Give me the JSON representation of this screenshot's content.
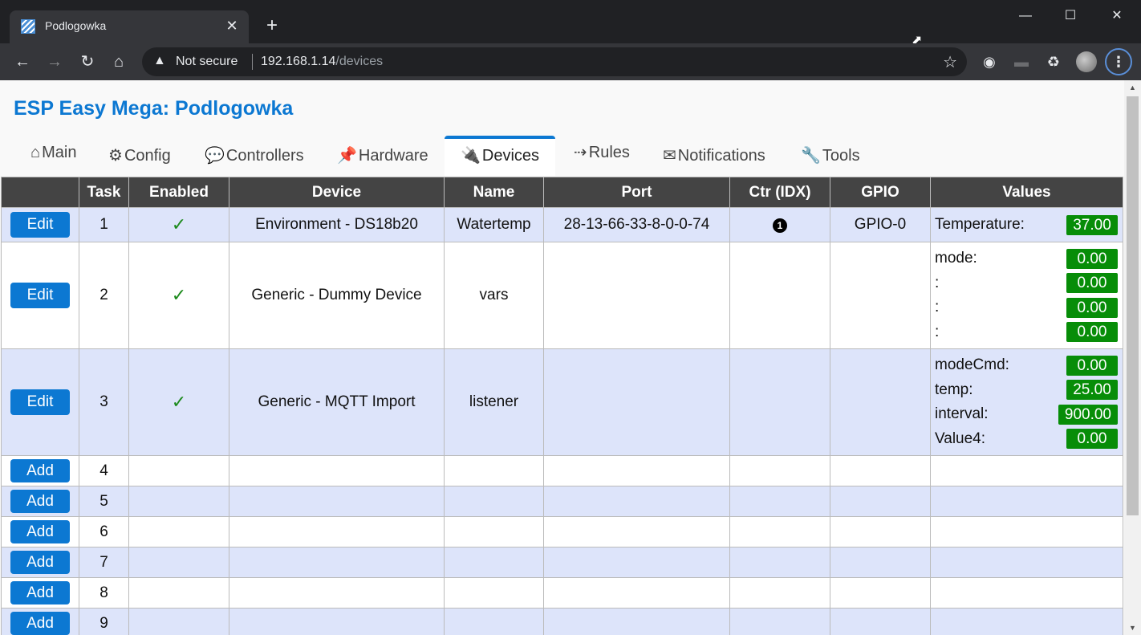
{
  "browser": {
    "tab_title": "Podlogowka",
    "tab_close": "✕",
    "new_tab": "+",
    "security_label": "Not secure",
    "url_host": "192.168.1.14",
    "url_path": "/devices"
  },
  "page": {
    "title": "ESP Easy Mega: Podlogowka"
  },
  "nav": {
    "main": {
      "icon": "⌂",
      "label": "Main"
    },
    "config": {
      "icon": "⚙",
      "label": "Config"
    },
    "controllers": {
      "icon": "💬",
      "label": "Controllers"
    },
    "hardware": {
      "icon": "📌",
      "label": "Hardware"
    },
    "devices": {
      "icon": "🔌",
      "label": "Devices"
    },
    "rules": {
      "icon": "⇢",
      "label": "Rules"
    },
    "notifications": {
      "icon": "✉",
      "label": "Notifications"
    },
    "tools": {
      "icon": "🔧",
      "label": "Tools"
    }
  },
  "table": {
    "headers": [
      "",
      "Task",
      "Enabled",
      "Device",
      "Name",
      "Port",
      "Ctr (IDX)",
      "GPIO",
      "Values"
    ],
    "rows": [
      {
        "button": "Edit",
        "task": "1",
        "enabled": "✓",
        "device": "Environment - DS18b20",
        "name": "Watertemp",
        "port": "28-13-66-33-8-0-0-74",
        "ctr": "1",
        "gpio": "GPIO-0",
        "values": [
          {
            "label": "Temperature:",
            "value": "37.00"
          }
        ]
      },
      {
        "button": "Edit",
        "task": "2",
        "enabled": "✓",
        "device": "Generic - Dummy Device",
        "name": "vars",
        "port": "",
        "ctr": "",
        "gpio": "",
        "values": [
          {
            "label": "mode:",
            "value": "0.00"
          },
          {
            "label": ":",
            "value": "0.00"
          },
          {
            "label": ":",
            "value": "0.00"
          },
          {
            "label": ":",
            "value": "0.00"
          }
        ]
      },
      {
        "button": "Edit",
        "task": "3",
        "enabled": "✓",
        "device": "Generic - MQTT Import",
        "name": "listener",
        "port": "",
        "ctr": "",
        "gpio": "",
        "values": [
          {
            "label": "modeCmd:",
            "value": "0.00"
          },
          {
            "label": "temp:",
            "value": "25.00"
          },
          {
            "label": "interval:",
            "value": "900.00"
          },
          {
            "label": "Value4:",
            "value": "0.00"
          }
        ]
      },
      {
        "button": "Add",
        "task": "4"
      },
      {
        "button": "Add",
        "task": "5"
      },
      {
        "button": "Add",
        "task": "6"
      },
      {
        "button": "Add",
        "task": "7"
      },
      {
        "button": "Add",
        "task": "8"
      },
      {
        "button": "Add",
        "task": "9"
      }
    ]
  }
}
